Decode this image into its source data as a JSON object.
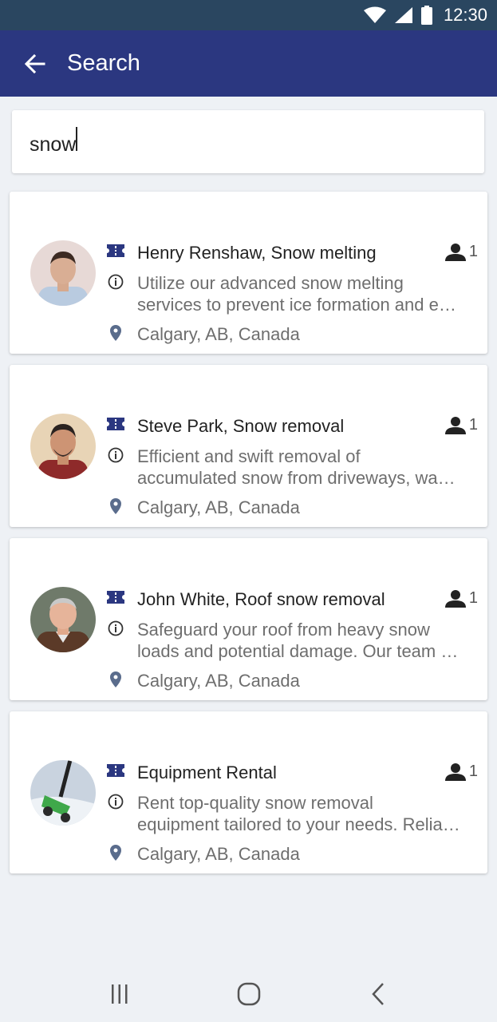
{
  "status_bar": {
    "time": "12:30",
    "icons": [
      "wifi-icon",
      "cell-signal-icon",
      "battery-icon"
    ]
  },
  "app_bar": {
    "title": "Search",
    "back_icon": "arrow-left-icon"
  },
  "search": {
    "value": "snow"
  },
  "results": [
    {
      "title": "Henry Renshaw, Snow melting",
      "desc_line1": "Utilize our advanced snow melting",
      "desc_line2": "services to prevent ice formation and e…",
      "location": "Calgary, AB, Canada",
      "count": "1"
    },
    {
      "title": "Steve Park, Snow removal",
      "desc_line1": "Efficient and swift removal of",
      "desc_line2": "accumulated snow from driveways, wa…",
      "location": "Calgary, AB, Canada",
      "count": "1"
    },
    {
      "title": "John White, Roof snow removal",
      "desc_line1": "Safeguard your roof from heavy snow",
      "desc_line2": "loads and potential damage. Our team …",
      "location": "Calgary, AB, Canada",
      "count": "1"
    },
    {
      "title": "Equipment Rental",
      "desc_line1": "Rent top-quality snow removal",
      "desc_line2": "equipment tailored to your needs. Relia…",
      "location": "Calgary, AB, Canada",
      "count": "1"
    }
  ],
  "colors": {
    "app_bar": "#2b3780",
    "status_bar": "#2a4660",
    "icon": "#2b3780",
    "background": "#eef1f5"
  },
  "nav_bar": {
    "icons": [
      "recents-icon",
      "home-icon",
      "back-icon"
    ]
  }
}
